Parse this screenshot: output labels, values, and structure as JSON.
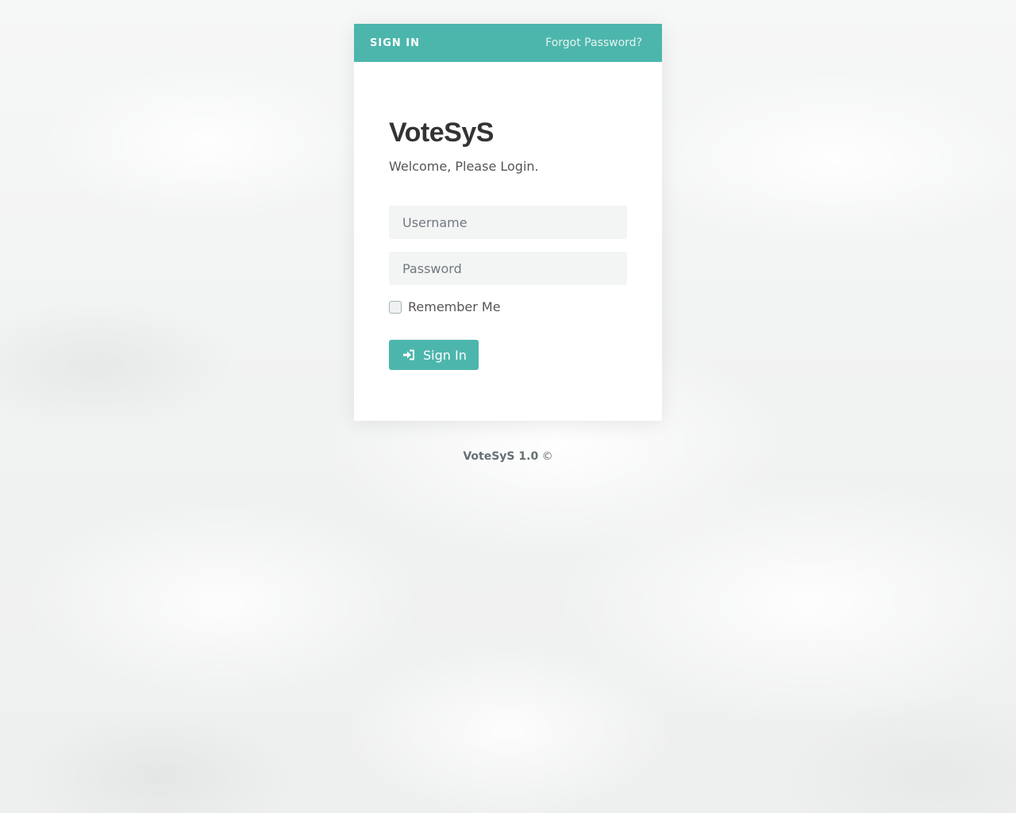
{
  "colors": {
    "accent": "#4db6ac",
    "panel_bg": "#ffffff",
    "input_bg": "#f3f4f4",
    "text_dark": "#333333"
  },
  "header": {
    "title": "SIGN IN",
    "forgot_link": "Forgot Password?"
  },
  "login": {
    "brand": "VoteSyS",
    "welcome": "Welcome, Please Login.",
    "username_placeholder": "Username",
    "password_placeholder": "Password",
    "remember_label": "Remember Me",
    "remember_checked": false,
    "submit_icon": "sign-in-icon",
    "submit_label": "Sign In"
  },
  "footer": {
    "version": "VoteSyS 1.0",
    "copyright": "©"
  }
}
